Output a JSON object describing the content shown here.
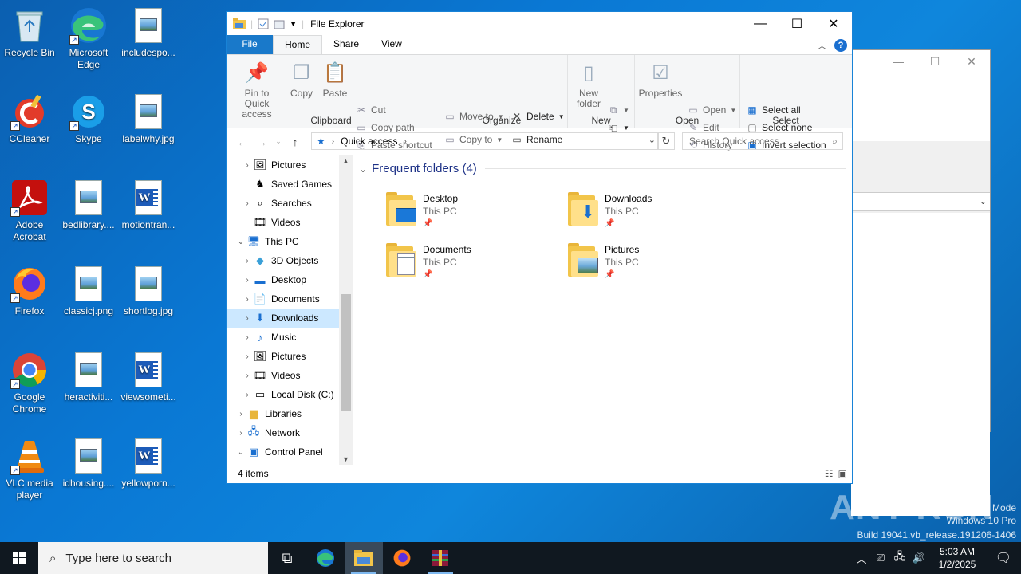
{
  "desktop": {
    "icons": [
      {
        "label": "Recycle Bin"
      },
      {
        "label": "Microsoft Edge"
      },
      {
        "label": "includespo..."
      },
      {
        "label": "CCleaner"
      },
      {
        "label": "Skype"
      },
      {
        "label": "labelwhy.jpg"
      },
      {
        "label": "Adobe Acrobat"
      },
      {
        "label": "bedlibrary...."
      },
      {
        "label": "motiontran..."
      },
      {
        "label": "Firefox"
      },
      {
        "label": "classicj.png"
      },
      {
        "label": "shortlog.jpg"
      },
      {
        "label": "Google Chrome"
      },
      {
        "label": "heractiviti..."
      },
      {
        "label": "viewsometi..."
      },
      {
        "label": "VLC media player"
      },
      {
        "label": "idhousing...."
      },
      {
        "label": "yellowporn..."
      }
    ]
  },
  "explorer": {
    "title": "File Explorer",
    "tabs": {
      "file": "File",
      "home": "Home",
      "share": "Share",
      "view": "View"
    },
    "help": "?",
    "clipboard": {
      "label": "Clipboard",
      "pin": "Pin to Quick access",
      "copy": "Copy",
      "paste": "Paste",
      "cut": "Cut",
      "copy_path": "Copy path",
      "paste_shortcut": "Paste shortcut"
    },
    "organize": {
      "label": "Organize",
      "move_to": "Move to",
      "copy_to": "Copy to",
      "delete": "Delete",
      "rename": "Rename"
    },
    "new": {
      "label": "New",
      "new_folder": "New folder"
    },
    "open": {
      "label": "Open",
      "properties": "Properties",
      "open": "Open",
      "edit": "Edit",
      "history": "History"
    },
    "select": {
      "label": "Select",
      "select_all": "Select all",
      "select_none": "Select none",
      "invert": "Invert selection"
    },
    "address": {
      "path": "Quick access",
      "search_placeholder": "Search Quick access"
    },
    "nav": [
      {
        "label": "Pictures"
      },
      {
        "label": "Saved Games"
      },
      {
        "label": "Searches"
      },
      {
        "label": "Videos"
      },
      {
        "label": "This PC"
      },
      {
        "label": "3D Objects"
      },
      {
        "label": "Desktop"
      },
      {
        "label": "Documents"
      },
      {
        "label": "Downloads"
      },
      {
        "label": "Music"
      },
      {
        "label": "Pictures"
      },
      {
        "label": "Videos"
      },
      {
        "label": "Local Disk (C:)"
      },
      {
        "label": "Libraries"
      },
      {
        "label": "Network"
      },
      {
        "label": "Control Panel"
      }
    ],
    "section_title": "Frequent folders (4)",
    "folders": [
      {
        "name": "Desktop",
        "location": "This PC"
      },
      {
        "name": "Downloads",
        "location": "This PC"
      },
      {
        "name": "Documents",
        "location": "This PC"
      },
      {
        "name": "Pictures",
        "location": "This PC"
      }
    ],
    "status": "4 items"
  },
  "watermark": {
    "brand": "ANY RUN",
    "line1": "Test Mode",
    "line2": "Windows 10 Pro",
    "line3": "Build 19041.vb_release.191206-1406"
  },
  "taskbar": {
    "search_placeholder": "Type here to search",
    "time": "5:03 AM",
    "date": "1/2/2025"
  }
}
